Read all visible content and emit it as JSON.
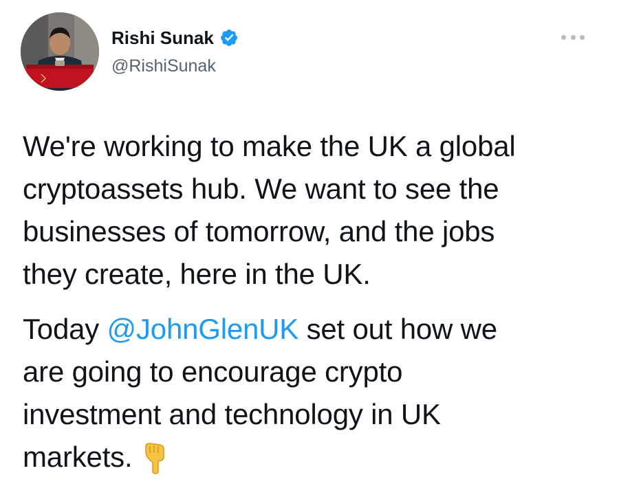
{
  "author": {
    "display_name": "Rishi Sunak",
    "handle": "@RishiSunak",
    "verified": true
  },
  "icons": {
    "avatar": "profile-photo",
    "verified": "verified-badge-icon",
    "more": "more-options-icon",
    "emoji": "backhand-index-pointing-down-emoji"
  },
  "colors": {
    "mention": "#1d9bf0",
    "verified": "#1d9bf0",
    "text": "#0f1419",
    "secondary": "#536471"
  },
  "tweet": {
    "paragraph1": {
      "line1": "We're working to make the UK a global",
      "line2": "cryptoassets hub. We want to see the",
      "line3": "businesses of tomorrow, and the jobs",
      "line4": "they create, here in the UK."
    },
    "paragraph2": {
      "line1_prefix": "Today ",
      "mention": "@JohnGlenUK",
      "line1_suffix": " set out how we",
      "line2": "are going to encourage crypto",
      "line3": "investment and technology in UK",
      "line4": "markets."
    }
  }
}
